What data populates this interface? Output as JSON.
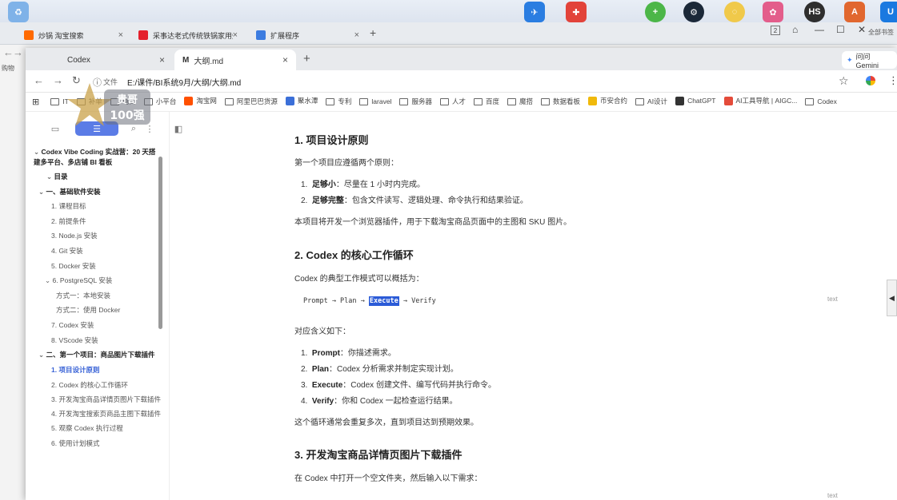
{
  "desktop": {
    "icons": [
      {
        "name": "app-icon-1",
        "color": "#2a7de1",
        "glyph": "✈"
      },
      {
        "name": "app-icon-2",
        "color": "#e2433a",
        "glyph": "✚"
      },
      {
        "name": "app-icon-3",
        "color": "#4cb648",
        "glyph": "+"
      },
      {
        "name": "steam-icon",
        "color": "#1b2838",
        "glyph": "⚙"
      },
      {
        "name": "app-icon-5",
        "color": "#f0c94a",
        "glyph": "◌"
      },
      {
        "name": "app-icon-6",
        "color": "#e35d8b",
        "glyph": "✿"
      },
      {
        "name": "hs-icon",
        "color": "#2e2e2e",
        "glyph": "HS"
      },
      {
        "name": "app-icon-8",
        "color": "#e1672f",
        "glyph": "A"
      },
      {
        "name": "app-icon-9",
        "color": "#1a79e0",
        "glyph": "U"
      }
    ]
  },
  "back_window": {
    "tabs": [
      {
        "label": "炒锅 淘宝搜索",
        "fav_color": "#ff6a00"
      },
      {
        "label": "采事达老式传统铁锅家用炒",
        "fav_color": "#e4202c"
      },
      {
        "label": "扩展程序",
        "fav_color": "#3c7ce0"
      }
    ],
    "right_text": "全部书签",
    "left_text": "购物"
  },
  "window": {
    "tabs": [
      {
        "label": "Codex",
        "active": false
      },
      {
        "label": "大纲.md",
        "active": true
      }
    ],
    "gemini_tab": "问问 Gemini",
    "url_label": "文件",
    "url": "E:/课件/BI系统9月/大纲/大纲.md"
  },
  "bookmarks": [
    {
      "label": "IT",
      "type": "folder"
    },
    {
      "label": "补单",
      "type": "folder"
    },
    {
      "label": "电商",
      "type": "folder"
    },
    {
      "label": "小平台",
      "type": "folder"
    },
    {
      "label": "淘宝网",
      "type": "site",
      "color": "#ff5000"
    },
    {
      "label": "阿里巴巴货源",
      "type": "folder"
    },
    {
      "label": "聚水潭",
      "type": "site",
      "color": "#3b6fd8"
    },
    {
      "label": "专利",
      "type": "folder"
    },
    {
      "label": "laravel",
      "type": "folder"
    },
    {
      "label": "服务器",
      "type": "folder"
    },
    {
      "label": "人才",
      "type": "folder"
    },
    {
      "label": "百度",
      "type": "folder"
    },
    {
      "label": "魔搭",
      "type": "folder"
    },
    {
      "label": "数据看板",
      "type": "folder"
    },
    {
      "label": "币安合约",
      "type": "site",
      "color": "#f0b90b"
    },
    {
      "label": "AI设计",
      "type": "folder"
    },
    {
      "label": "ChatGPT",
      "type": "site",
      "color": "#333333"
    },
    {
      "label": "AI工具导航 | AIGC...",
      "type": "site",
      "color": "#e44b3a"
    },
    {
      "label": "Codex",
      "type": "folder"
    }
  ],
  "sidebar": {
    "toc": [
      {
        "text": "Codex Vibe Coding 实战营：20 天搭建多平台、多店铺 BI 看板",
        "level": "h1",
        "indent": 0
      },
      {
        "text": "目录",
        "level": "h2",
        "indent": 16
      },
      {
        "text": "一、基础软件安装",
        "level": "h2",
        "indent": 6
      },
      {
        "text": "1. 课程目标",
        "level": "h3",
        "indent": 22
      },
      {
        "text": "2. 前提条件",
        "level": "h3",
        "indent": 22
      },
      {
        "text": "3. Node.js 安装",
        "level": "h3",
        "indent": 22
      },
      {
        "text": "4. Git 安装",
        "level": "h3",
        "indent": 22
      },
      {
        "text": "5. Docker 安装",
        "level": "h3",
        "indent": 22
      },
      {
        "text": "6. PostgreSQL 安装",
        "level": "h3",
        "indent": 14
      },
      {
        "text": "方式一：本地安装",
        "level": "h4",
        "indent": 28
      },
      {
        "text": "方式二：使用 Docker",
        "level": "h4",
        "indent": 28
      },
      {
        "text": "7. Codex 安装",
        "level": "h3",
        "indent": 22
      },
      {
        "text": "8. VScode 安装",
        "level": "h3",
        "indent": 22
      },
      {
        "text": "二、第一个项目：商品图片下载插件",
        "level": "h2w",
        "indent": 6
      },
      {
        "text": "1. 项目设计原则",
        "level": "active",
        "indent": 22
      },
      {
        "text": "2. Codex 的核心工作循环",
        "level": "h3",
        "indent": 22
      },
      {
        "text": "3. 开发淘宝商品详情页图片下载插件",
        "level": "wrap",
        "indent": 22
      },
      {
        "text": "4. 开发淘宝搜索页商品主图下载插件",
        "level": "wrap",
        "indent": 22
      },
      {
        "text": "5. 观察 Codex 执行过程",
        "level": "h3",
        "indent": 22
      },
      {
        "text": "6. 使用计划模式",
        "level": "h3",
        "indent": 22
      }
    ]
  },
  "doc": {
    "h1": "1. 项目设计原则",
    "p1": "第一个项目应遵循两个原则：",
    "list1": [
      {
        "num": "1.",
        "bold": "足够小",
        "rest": "：尽量在 1 小时内完成。"
      },
      {
        "num": "2.",
        "bold": "足够完整",
        "rest": "：包含文件读写、逻辑处理、命令执行和结果验证。"
      }
    ],
    "p2": "本项目将开发一个浏览器插件，用于下载淘宝商品页面中的主图和 SKU 图片。",
    "h2": "2. Codex 的核心工作循环",
    "p3": "Codex 的典型工作模式可以概括为：",
    "code_pre": "Prompt → Plan → ",
    "code_hl": "Execute",
    "code_post": " → Verify",
    "code_lang": "text",
    "p4": "对应含义如下：",
    "list2": [
      {
        "num": "1.",
        "bold": "Prompt",
        "rest": "：你描述需求。"
      },
      {
        "num": "2.",
        "bold": "Plan",
        "rest": "：Codex 分析需求并制定实现计划。"
      },
      {
        "num": "3.",
        "bold": "Execute",
        "rest": "：Codex 创建文件、编写代码并执行命令。"
      },
      {
        "num": "4.",
        "bold": "Verify",
        "rest": "：你和 Codex 一起检查运行结果。"
      }
    ],
    "p5": "这个循环通常会重复多次，直到项目达到预期效果。",
    "h3": "3. 开发淘宝商品详情页图片下载插件",
    "p6": "在 Codex 中打开一个空文件夹，然后输入以下需求：",
    "code_lang2": "text"
  },
  "watermark": {
    "top": "贵哥",
    "bottom": "100强"
  }
}
